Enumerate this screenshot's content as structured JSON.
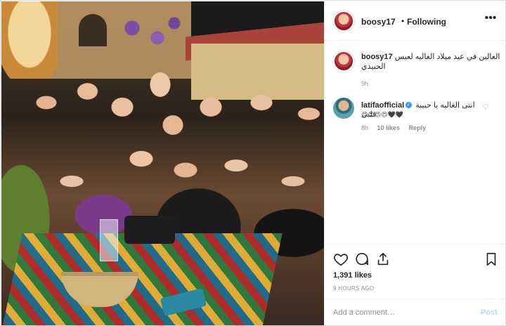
{
  "post": {
    "username": "boosy17",
    "follow_state": "Following",
    "dot": "•",
    "more": "•••"
  },
  "caption": {
    "username": "boosy17",
    "text": "الغالين في عيد ميلاد الغاليه لعيس الحبيدي",
    "time": "9h"
  },
  "comment": {
    "username": "latifaofficial",
    "verified": "✓",
    "text": "انتى الغاليه يا حبيبة قلبى",
    "emojis": "😍😍😍😍🖤🖤",
    "time": "8h",
    "likes": "10 likes",
    "reply": "Reply",
    "heart": "♡"
  },
  "actions": {
    "like_icon": "heart-outline-icon",
    "comment_icon": "comment-bubble-icon",
    "share_icon": "share-icon",
    "save_icon": "bookmark-icon",
    "likes_count": "1,391 likes",
    "posted_ago": "9 HOURS AGO"
  },
  "add_comment": {
    "placeholder": "Add a comment…",
    "post_label": "Post"
  },
  "colors": {
    "border": "#dbdbdb",
    "secondary_text": "#8e8e8e",
    "post_disabled": "#b3dbff",
    "verified": "#3897f0"
  }
}
